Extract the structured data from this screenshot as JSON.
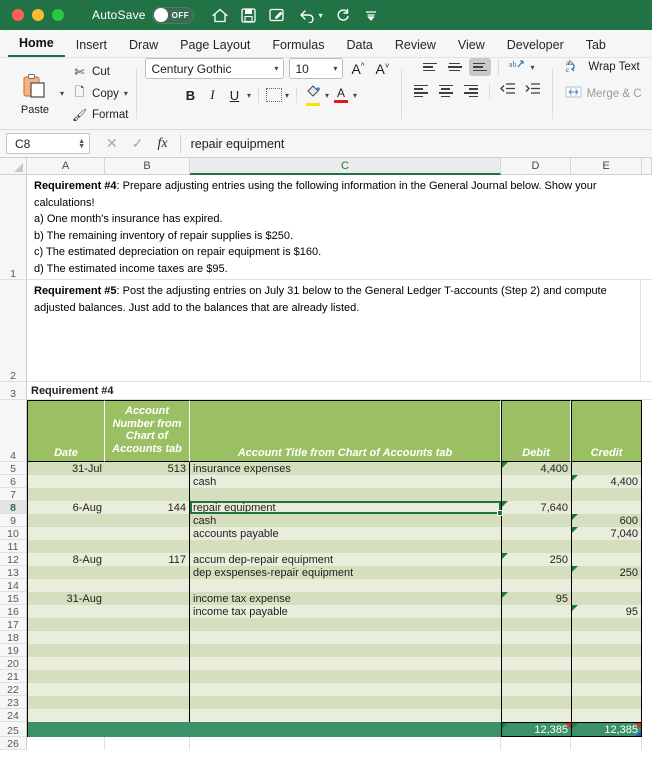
{
  "titlebar": {
    "autosave_label": "AutoSave",
    "autosave_state": "OFF",
    "icons": [
      "home-icon",
      "save-icon",
      "new-comment-icon",
      "undo-icon",
      "undo-dropdown-caret",
      "redo-icon",
      "customize-toolbar-caret"
    ],
    "brand_color": "#217346"
  },
  "ribbon_tabs": [
    {
      "label": "Home",
      "active": true
    },
    {
      "label": "Insert",
      "active": false
    },
    {
      "label": "Draw",
      "active": false
    },
    {
      "label": "Page Layout",
      "active": false
    },
    {
      "label": "Formulas",
      "active": false
    },
    {
      "label": "Data",
      "active": false
    },
    {
      "label": "Review",
      "active": false
    },
    {
      "label": "View",
      "active": false
    },
    {
      "label": "Developer",
      "active": false
    },
    {
      "label": "Tab",
      "active": false
    }
  ],
  "ribbon": {
    "paste_label": "Paste",
    "cut_label": "Cut",
    "copy_label": "Copy",
    "format_label": "Format",
    "font_name": "Century Gothic",
    "font_size": "10",
    "bold_label": "B",
    "italic_label": "I",
    "underline_label": "U",
    "grow_font_label": "A",
    "shrink_font_label": "A",
    "wrap_text_label": "Wrap Text",
    "merge_center_label": "Merge & C"
  },
  "formula_bar": {
    "name_box": "C8",
    "formula_value": "repair equipment",
    "cancel_icon": "close-icon",
    "enter_icon": "check-icon",
    "function_icon": "fx-icon"
  },
  "grid": {
    "columns": [
      "A",
      "B",
      "C",
      "D",
      "E"
    ],
    "selected_column": "C",
    "selected_row": 8,
    "row_numbers": [
      1,
      2,
      3,
      4,
      5,
      6,
      7,
      8,
      9,
      10,
      11,
      12,
      13,
      14,
      15,
      16,
      17,
      18,
      19,
      20,
      21,
      22,
      23,
      24,
      25,
      26
    ],
    "text_blocks": {
      "req4_prefix": "Requirement #4",
      "req4_body": ": Prepare adjusting entries using the following information in the General Journal below. Show your calculations!\na) One month's insurance has expired.\nb) The remaining inventory of repair supplies is $250.\nc) The estimated depreciation on repair equipment is $160.\nd) The estimated income taxes are $95.",
      "req5_prefix": "Requirement #5",
      "req5_body": ": Post the adjusting entries on July 31 below to the General Ledger T-accounts (Step 2) and compute adjusted balances. Just add to the balances that are already listed.",
      "req4_heading": "Requirement #4"
    },
    "table_headers": {
      "date": "Date",
      "account_number": "Account Number from Chart of Accounts tab",
      "account_title": "Account Title from Chart of Accounts tab",
      "debit": "Debit",
      "credit": "Credit"
    },
    "table_rows": [
      {
        "row": 5,
        "date": "31-Jul",
        "number": "513",
        "title": "insurance expenses",
        "debit": "4,400",
        "credit": "",
        "note_d": true,
        "note_e": false
      },
      {
        "row": 6,
        "date": "",
        "number": "",
        "title": "cash",
        "debit": "",
        "credit": "4,400",
        "note_d": false,
        "note_e": true
      },
      {
        "row": 7,
        "date": "",
        "number": "",
        "title": "",
        "debit": "",
        "credit": "",
        "note_d": false,
        "note_e": false
      },
      {
        "row": 8,
        "date": "6-Aug",
        "number": "144",
        "title": "repair equipment",
        "debit": "7,640",
        "credit": "",
        "note_d": true,
        "note_e": false
      },
      {
        "row": 9,
        "date": "",
        "number": "",
        "title": "cash",
        "debit": "",
        "credit": "600",
        "note_d": false,
        "note_e": true
      },
      {
        "row": 10,
        "date": "",
        "number": "",
        "title": "accounts payable",
        "debit": "",
        "credit": "7,040",
        "note_d": false,
        "note_e": true
      },
      {
        "row": 11,
        "date": "",
        "number": "",
        "title": "",
        "debit": "",
        "credit": "",
        "note_d": false,
        "note_e": false
      },
      {
        "row": 12,
        "date": "8-Aug",
        "number": "117",
        "title": "accum dep-repair equipment",
        "debit": "250",
        "credit": "",
        "note_d": true,
        "note_e": false
      },
      {
        "row": 13,
        "date": "",
        "number": "",
        "title": "dep exspenses-repair equipment",
        "debit": "",
        "credit": "250",
        "note_d": false,
        "note_e": true
      },
      {
        "row": 14,
        "date": "",
        "number": "",
        "title": "",
        "debit": "",
        "credit": "",
        "note_d": false,
        "note_e": false
      },
      {
        "row": 15,
        "date": "31-Aug",
        "number": "",
        "title": "income tax expense",
        "debit": "95",
        "credit": "",
        "note_d": true,
        "note_e": false
      },
      {
        "row": 16,
        "date": "",
        "number": "",
        "title": "income tax payable",
        "debit": "",
        "credit": "95",
        "note_d": false,
        "note_e": true
      },
      {
        "row": 17,
        "date": "",
        "number": "",
        "title": "",
        "debit": "",
        "credit": "",
        "note_d": false,
        "note_e": false
      },
      {
        "row": 18,
        "date": "",
        "number": "",
        "title": "",
        "debit": "",
        "credit": "",
        "note_d": false,
        "note_e": false
      },
      {
        "row": 19,
        "date": "",
        "number": "",
        "title": "",
        "debit": "",
        "credit": "",
        "note_d": false,
        "note_e": false
      },
      {
        "row": 20,
        "date": "",
        "number": "",
        "title": "",
        "debit": "",
        "credit": "",
        "note_d": false,
        "note_e": false
      },
      {
        "row": 21,
        "date": "",
        "number": "",
        "title": "",
        "debit": "",
        "credit": "",
        "note_d": false,
        "note_e": false
      },
      {
        "row": 22,
        "date": "",
        "number": "",
        "title": "",
        "debit": "",
        "credit": "",
        "note_d": false,
        "note_e": false
      },
      {
        "row": 23,
        "date": "",
        "number": "",
        "title": "",
        "debit": "",
        "credit": "",
        "note_d": false,
        "note_e": false
      },
      {
        "row": 24,
        "date": "",
        "number": "",
        "title": "",
        "debit": "",
        "credit": "",
        "note_d": false,
        "note_e": false
      }
    ],
    "total_row": {
      "row": 25,
      "debit": "12,385",
      "credit": "12,385"
    },
    "colors": {
      "header_green": "#9bc063",
      "total_green": "#3c9268",
      "band_dark": "#d6dfbd",
      "band_light": "#e9eedc",
      "selection": "#217346"
    }
  }
}
